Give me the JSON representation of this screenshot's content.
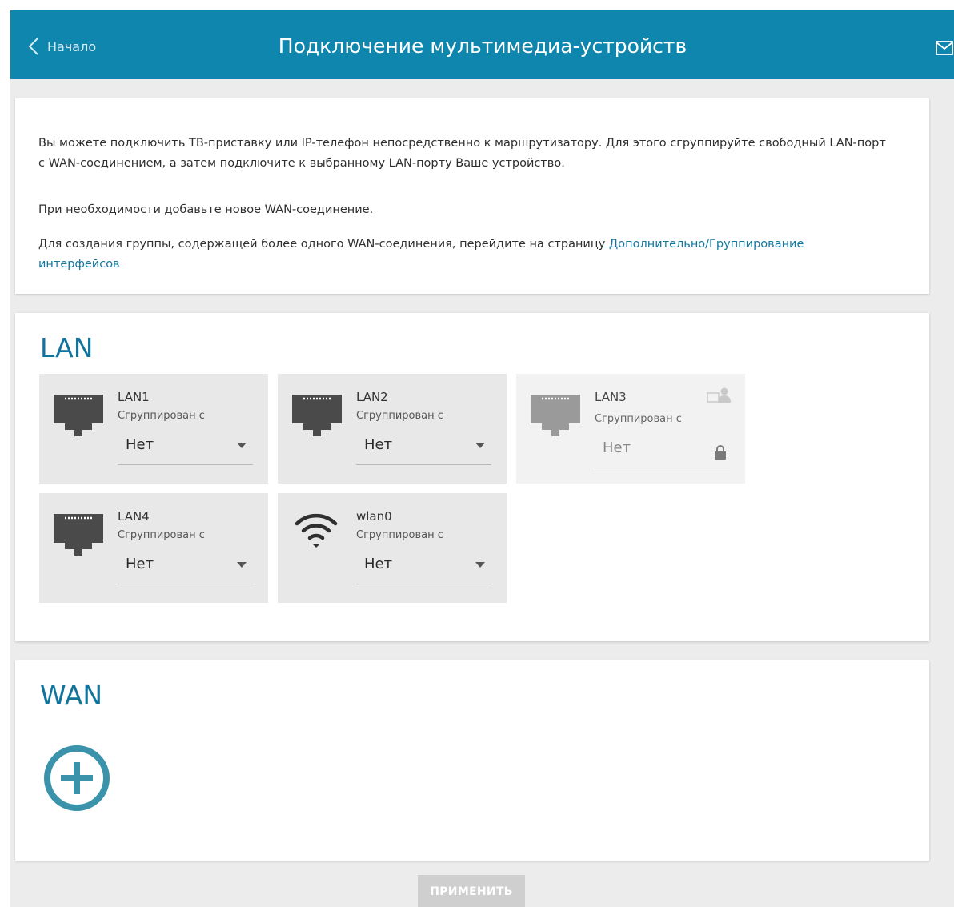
{
  "header": {
    "back_label": "Начало",
    "title": "Подключение мультимедиа-устройств",
    "accent_color": "#0f86ad"
  },
  "info": {
    "paragraph1": "Вы можете подключить ТВ-приставку или IP-телефон непосредственно к маршрутизатору. Для этого сгруппируйте свободный LAN-порт с WAN-соединением, а затем подключите к выбранному LAN-порту Ваше устройство.",
    "paragraph2": "При необходимости добавьте новое WAN-соединение.",
    "paragraph3_text": "Для создания группы, содержащей более одного WAN-соединения, перейдите на страницу ",
    "paragraph3_link": "Дополнительно/Группирование интерфейсов"
  },
  "lan": {
    "title": "LAN",
    "ports": [
      {
        "name": "LAN1",
        "sub": "Сгруппирован с",
        "value": "Нет",
        "icon": "ethernet-port-icon",
        "disabled": false
      },
      {
        "name": "LAN2",
        "sub": "Сгруппирован с",
        "value": "Нет",
        "icon": "ethernet-port-icon",
        "disabled": false
      },
      {
        "name": "LAN3",
        "sub": "Сгруппирован с",
        "value": "Нет",
        "icon": "ethernet-port-icon",
        "disabled": true
      },
      {
        "name": "LAN4",
        "sub": "Сгруппирован с",
        "value": "Нет",
        "icon": "ethernet-port-icon",
        "disabled": false
      },
      {
        "name": "wlan0",
        "sub": "Сгруппирован с",
        "value": "Нет",
        "icon": "wifi-icon",
        "disabled": false
      }
    ]
  },
  "wan": {
    "title": "WAN",
    "add_icon": "add-circle-icon"
  },
  "apply_label": "ПРИМЕНИТЬ"
}
